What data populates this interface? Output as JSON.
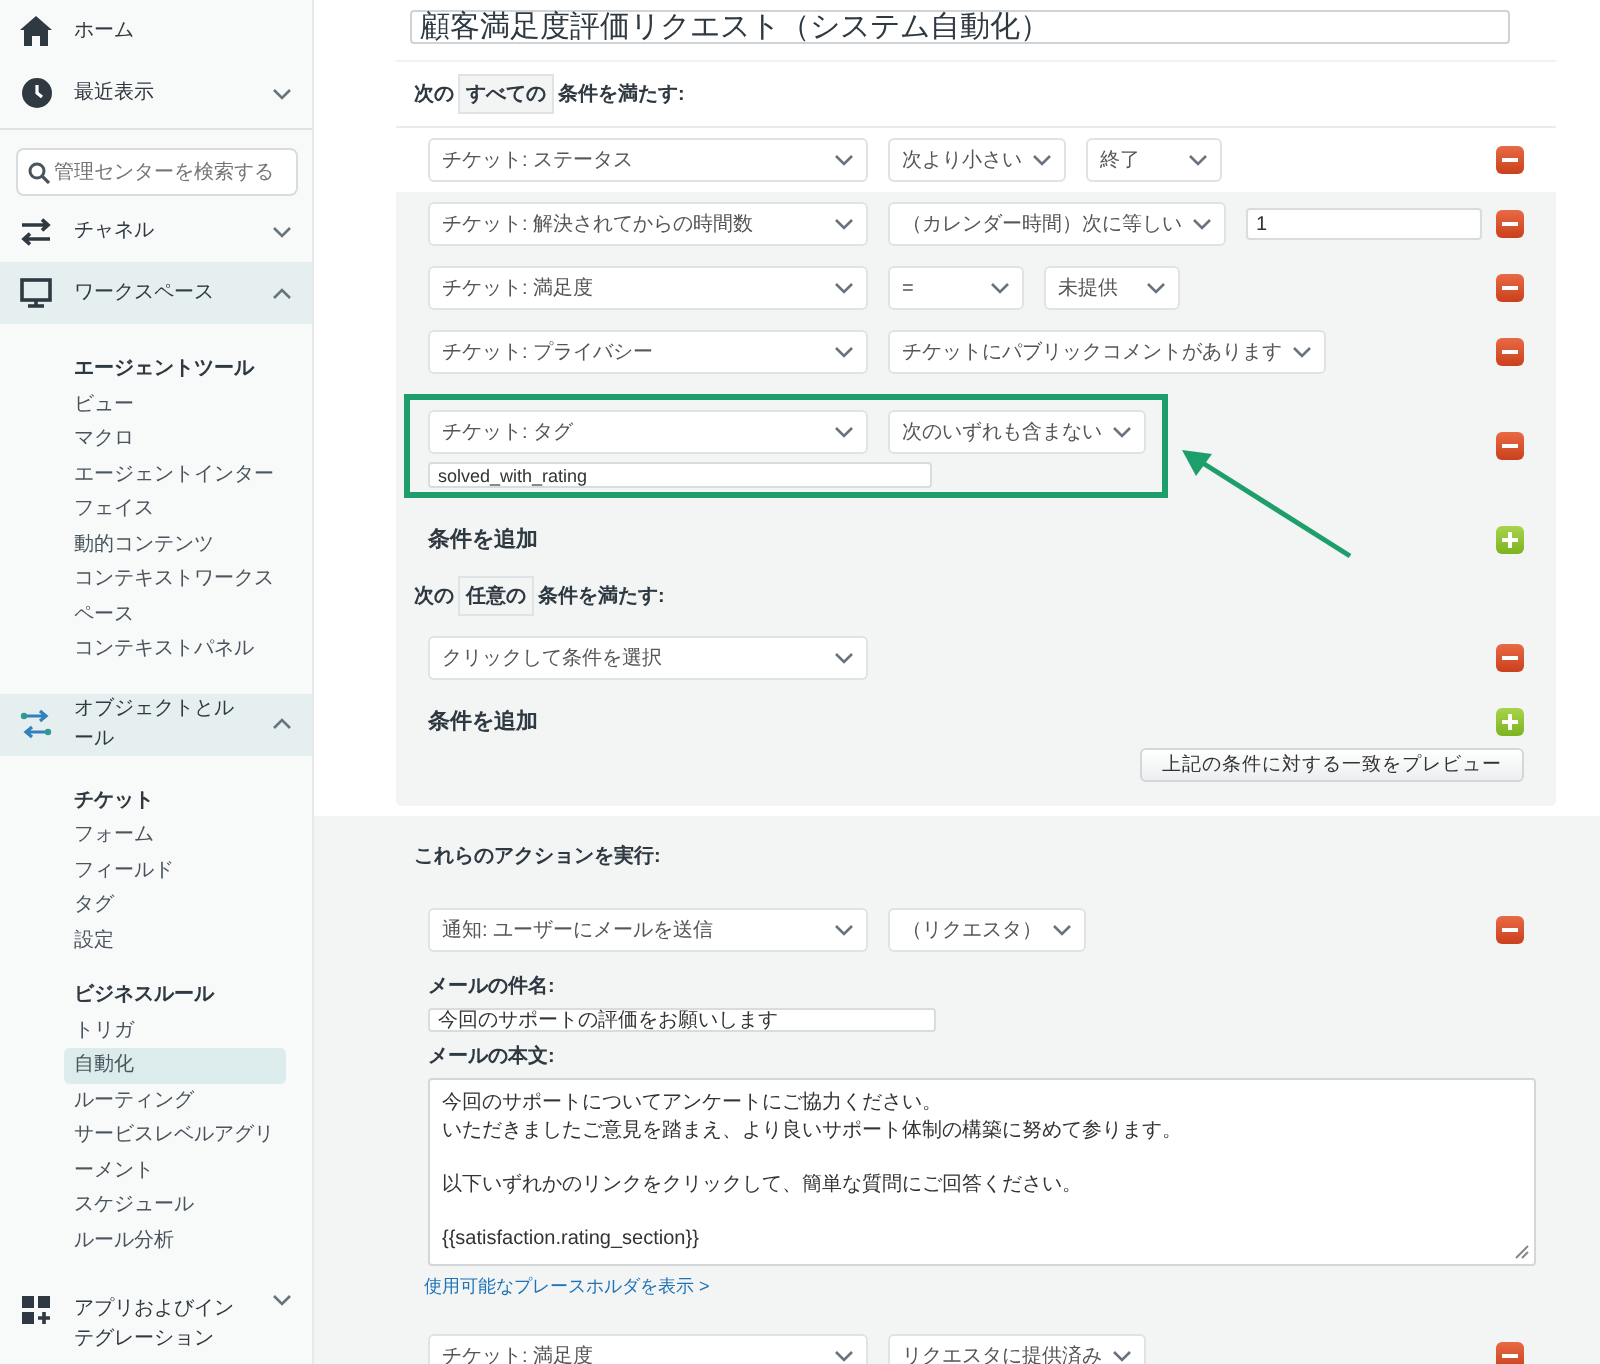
{
  "sidebar": {
    "items": [
      {
        "kind": "link",
        "label": "ホーム"
      },
      {
        "kind": "section",
        "label": "最近表示",
        "expanded": false
      },
      {
        "kind": "search",
        "placeholder": "管理センターを検索する"
      },
      {
        "kind": "section",
        "label": "チャネル",
        "expanded": false
      },
      {
        "kind": "section",
        "label": "ワークスペース",
        "expanded": true,
        "groups": [
          {
            "heading": "エージェントツール",
            "items": [
              {
                "label": "ビュー",
                "selected": false
              },
              {
                "label": "マクロ",
                "selected": false
              },
              {
                "label": "エージェントインターフェイス",
                "selected": false
              },
              {
                "label": "動的コンテンツ",
                "selected": false
              },
              {
                "label": "コンテキストワークスペース",
                "selected": false
              },
              {
                "label": "コンテキストパネル",
                "selected": false
              }
            ]
          }
        ]
      },
      {
        "kind": "section",
        "label": "オブジェクトとルール",
        "expanded": true,
        "groups": [
          {
            "heading": "チケット",
            "items": [
              {
                "label": "フォーム",
                "selected": false
              },
              {
                "label": "フィールド",
                "selected": false
              },
              {
                "label": "タグ",
                "selected": false
              },
              {
                "label": "設定",
                "selected": false
              }
            ]
          },
          {
            "heading": "ビジネスルール",
            "items": [
              {
                "label": "トリガ",
                "selected": false
              },
              {
                "label": "自動化",
                "selected": true
              },
              {
                "label": "ルーティング",
                "selected": false
              },
              {
                "label": "サービスレベルアグリーメント",
                "selected": false
              },
              {
                "label": "スケジュール",
                "selected": false
              },
              {
                "label": "ルール分析",
                "selected": false
              }
            ]
          }
        ]
      },
      {
        "kind": "section",
        "label": "アプリおよびインテグレーション",
        "expanded": false
      }
    ]
  },
  "title_field": {
    "value": "顧客満足度評価リクエスト（システム自動化）"
  },
  "conditions_all": {
    "prefix": "次の",
    "qualifier": "すべての",
    "suffix": "条件を満たす:",
    "add_label": "条件を追加",
    "rows": [
      {
        "highlighted": false,
        "fields": [
          {
            "kind": "select",
            "value": "チケット: ステータス"
          },
          {
            "kind": "select",
            "value": "次より小さい"
          },
          {
            "kind": "select",
            "value": "終了"
          }
        ]
      },
      {
        "highlighted": false,
        "fields": [
          {
            "kind": "select",
            "value": "チケット: 解決されてからの時間数"
          },
          {
            "kind": "select",
            "value": "（カレンダー時間）次に等しい"
          },
          {
            "kind": "input",
            "value": "1"
          }
        ]
      },
      {
        "highlighted": false,
        "fields": [
          {
            "kind": "select",
            "value": "チケット: 満足度"
          },
          {
            "kind": "select",
            "value": "="
          },
          {
            "kind": "select",
            "value": "未提供"
          }
        ]
      },
      {
        "highlighted": false,
        "fields": [
          {
            "kind": "select",
            "value": "チケット: プライバシー"
          },
          {
            "kind": "select",
            "value": "チケットにパブリックコメントがあります"
          }
        ]
      },
      {
        "highlighted": true,
        "fields": [
          {
            "kind": "select",
            "value": "チケット: タグ"
          },
          {
            "kind": "select",
            "value": "次のいずれも含まない"
          },
          {
            "kind": "tag_input",
            "value": "solved_with_rating"
          }
        ]
      }
    ]
  },
  "conditions_any": {
    "prefix": "次の",
    "qualifier": "任意の",
    "suffix": "条件を満たす:",
    "add_label": "条件を追加",
    "rows": [
      {
        "highlighted": false,
        "fields": [
          {
            "kind": "select",
            "value": "クリックして条件を選択"
          }
        ]
      }
    ]
  },
  "preview_button": "上記の条件に対する一致をプレビュー",
  "actions": {
    "heading": "これらのアクションを実行:",
    "rows": [
      {
        "fields": [
          {
            "kind": "select",
            "value": "通知: ユーザーにメールを送信"
          },
          {
            "kind": "select",
            "value": "（リクエスタ）"
          }
        ],
        "email": {
          "subject_label": "メールの件名:",
          "subject": "今回のサポートの評価をお願いします",
          "body_label": "メールの本文:",
          "body": [
            [
              "今回のサポートについてアンケートにご協力ください。",
              "いただきましたご意見を踏まえ、より良いサポート体制の構築に努めて参ります。"
            ],
            [
              "以下いずれかのリンクをクリックして、簡単な質問にご回答ください。"
            ],
            [
              "{{satisfaction.rating_section}}"
            ]
          ],
          "placeholders_link": "使用可能なプレースホルダを表示 >"
        }
      },
      {
        "fields": [
          {
            "kind": "select",
            "value": "チケット: 満足度"
          },
          {
            "kind": "select",
            "value": "リクエスタに提供済み"
          }
        ]
      }
    ]
  }
}
